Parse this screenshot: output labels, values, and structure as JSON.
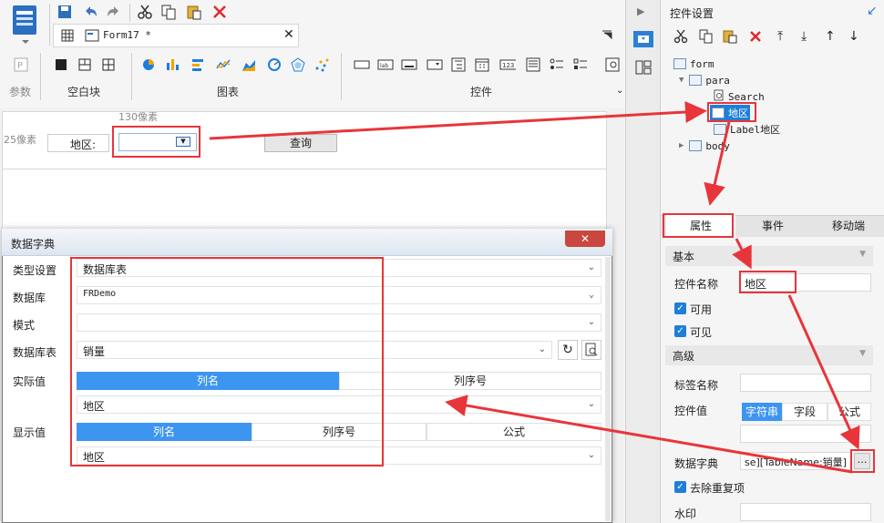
{
  "toolbar": {
    "tab_title": "Form17 *",
    "groups": {
      "params": "参数",
      "blank": "空白块",
      "charts": "图表",
      "controls": "控件"
    },
    "colors": {
      "save": "#2f6fb9",
      "undo": "#3e74c0",
      "cut": "#333333",
      "delete": "#e0282e",
      "chart_blue": "#1a7ee0",
      "chart_gold": "#f0a300"
    }
  },
  "canvas": {
    "width_label": "130像素",
    "height_label": "25像素",
    "region_label": "地区:",
    "query_button": "查询"
  },
  "panel": {
    "title": "控件设置",
    "tree": {
      "form": "form",
      "para": "para",
      "search": "Search",
      "region": "地区",
      "label_region": "Label地区",
      "body": "body"
    },
    "tabs": {
      "attributes": "属性",
      "events": "事件",
      "mobile": "移动端"
    },
    "sections": {
      "basic": "基本",
      "advanced": "高级"
    },
    "fields": {
      "control_name_label": "控件名称",
      "control_name_value": "地区",
      "enabled_label": "可用",
      "visible_label": "可见",
      "tag_name_label": "标签名称",
      "control_value_label": "控件值",
      "value_types": [
        "字符串",
        "字段",
        "公式"
      ],
      "dict_label": "数据字典",
      "dict_value": "se][TableName:销量]",
      "dict_button": "…",
      "dedupe_label": "去除重复项",
      "watermark_label": "水印"
    }
  },
  "dialog": {
    "title": "数据字典",
    "type_label": "类型设置",
    "type_value": "数据库表",
    "database_label": "数据库",
    "database_value": "FRDemo",
    "schema_label": "模式",
    "schema_value": "",
    "table_label": "数据库表",
    "table_value": "销量",
    "actual_label": "实际值",
    "actual_modes": [
      "列名",
      "列序号"
    ],
    "actual_value": "地区",
    "display_label": "显示值",
    "display_modes": [
      "列名",
      "列序号",
      "公式"
    ],
    "display_value": "地区"
  },
  "colors": {
    "highlight": "#e8353b",
    "accent": "#3d95f2",
    "selected_tree": "#1e7fd8"
  }
}
